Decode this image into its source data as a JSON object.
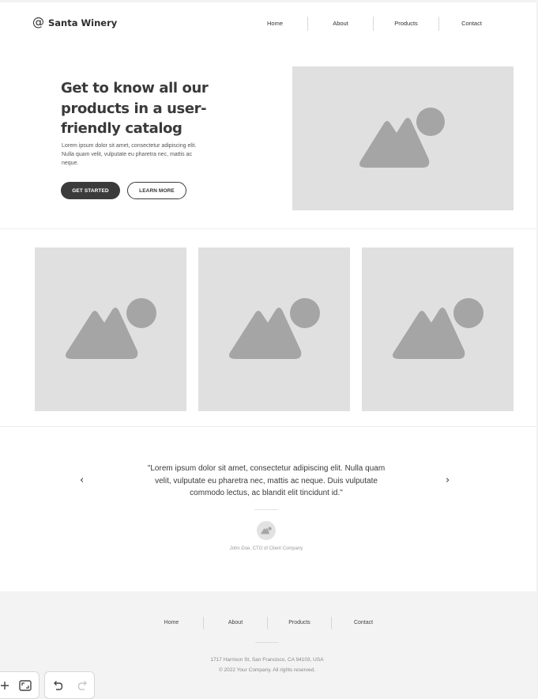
{
  "header": {
    "logo_symbol": "@",
    "brand_name": "Santa Winery",
    "nav": [
      "Home",
      "About",
      "Products",
      "Contact"
    ]
  },
  "hero": {
    "title": "Get to know all our products in a user-friendly catalog",
    "text": "Lorem ipsum dolor sit amet, consectetur adipiscing elit. Nulla quam velit, vulputate eu pharetra nec, mattis ac neque.",
    "primary_button": "GET STARTED",
    "secondary_button": "LEARN MORE",
    "image_icon": "image-placeholder-icon"
  },
  "gallery": {
    "image_icon": "image-placeholder-icon",
    "count": 3
  },
  "testimonial": {
    "quote": "\"Lorem ipsum dolor sit amet, consectetur adipiscing elit. Nulla quam velit, vulputate eu pharetra nec, mattis ac neque. Duis vulputate commodo lectus, ac blandit elit tincidunt id.\"",
    "prev_icon": "chevron-left-icon",
    "next_icon": "chevron-right-icon",
    "author": "John Doe, CTO of Client Company"
  },
  "footer": {
    "nav": [
      "Home",
      "About",
      "Products",
      "Contact"
    ],
    "address": "1717 Harrison St, San Francisco, CA 94103, USA",
    "copyright": "© 2022 Your Company.  All rights reserved."
  },
  "toolbar": {
    "icons": [
      "add-icon",
      "fit-screen-icon",
      "undo-icon",
      "redo-icon"
    ]
  },
  "colors": {
    "dark": "#3b3b3b",
    "placeholder_bg": "#e0e0e0",
    "placeholder_fg": "#a5a5a5",
    "footer_bg": "#f4f3f3"
  }
}
